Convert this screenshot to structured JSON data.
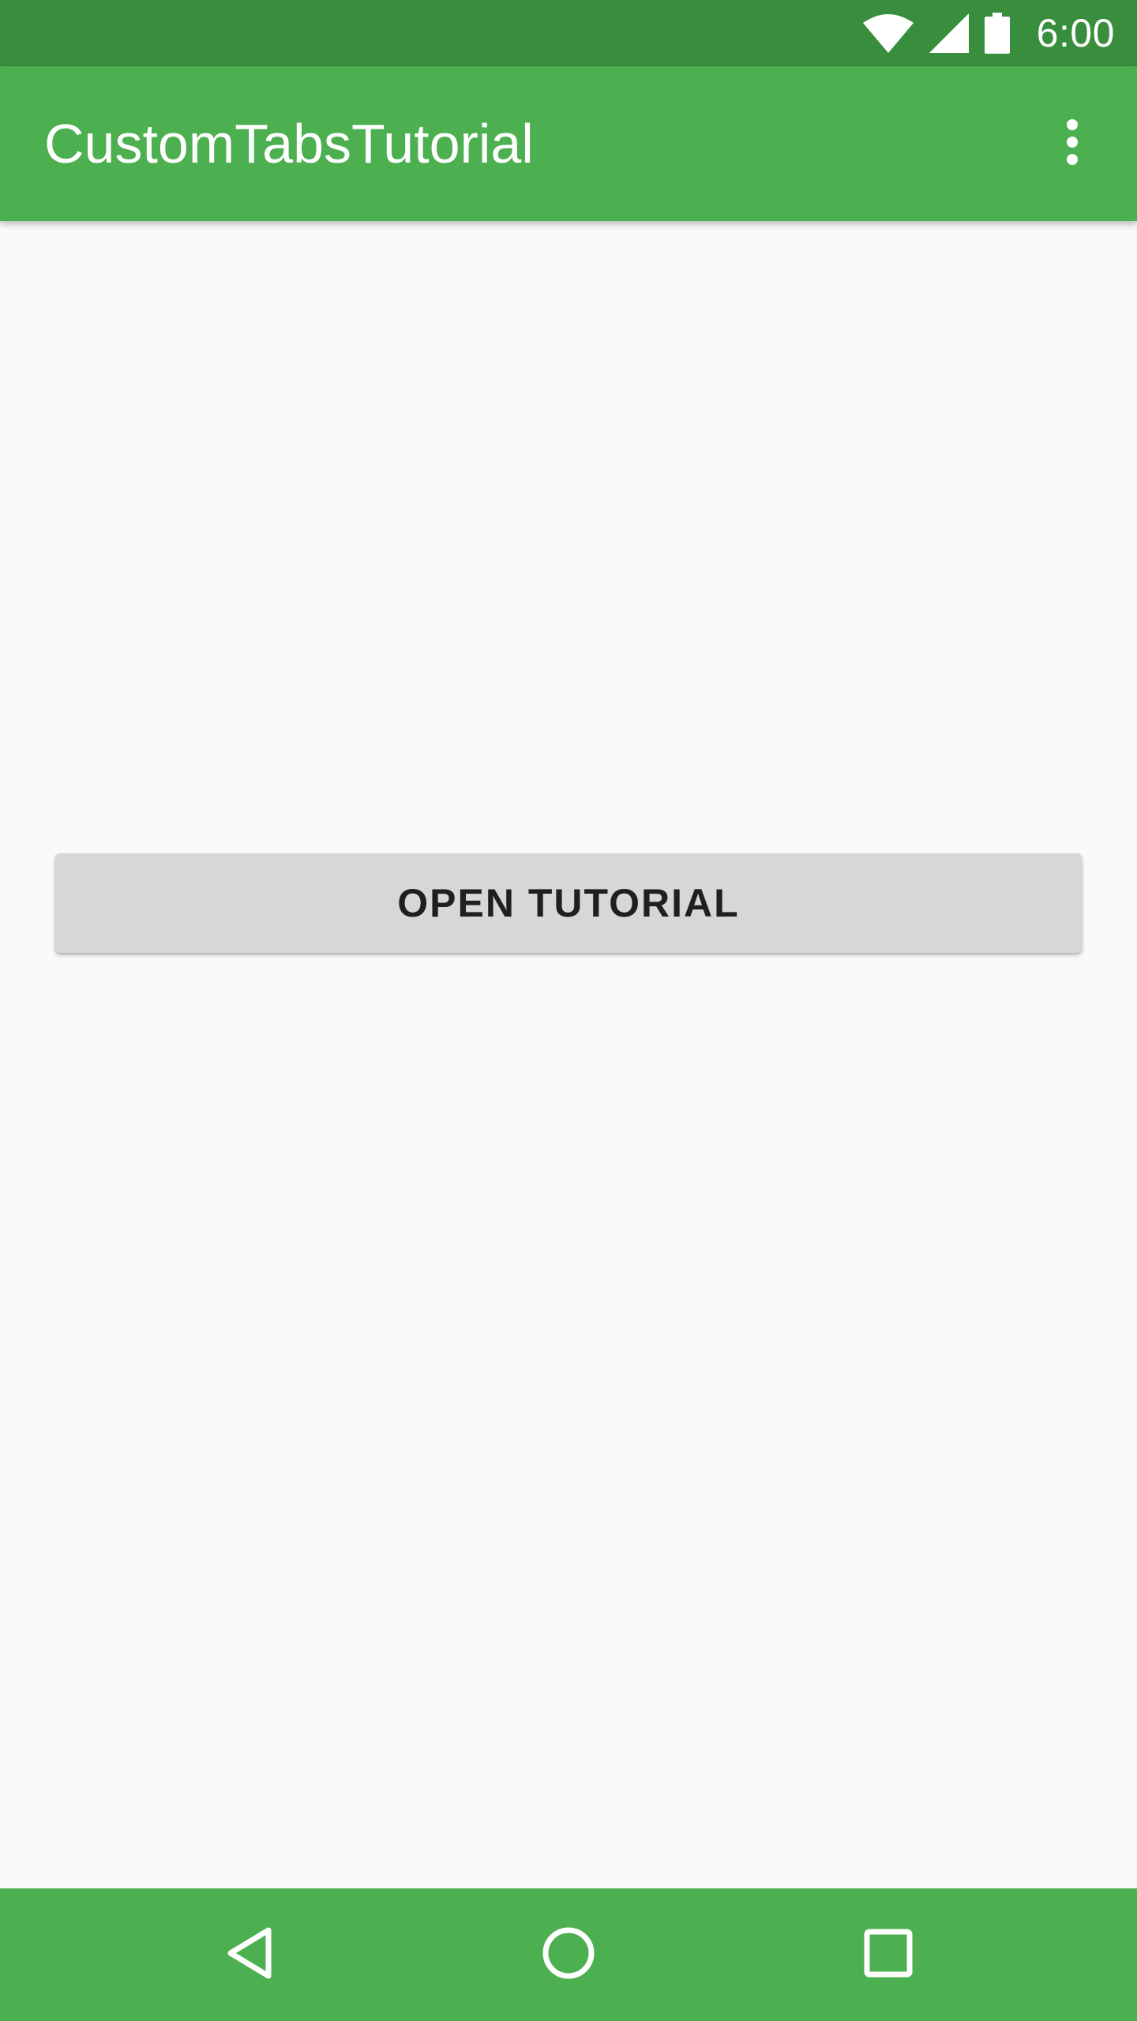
{
  "status_bar": {
    "time": "6:00",
    "icons": [
      "wifi-icon",
      "cell-signal-icon",
      "battery-icon"
    ],
    "color": "#388E3C"
  },
  "app_bar": {
    "title": "CustomTabsTutorial",
    "overflow_icon": "more-vert-icon",
    "color": "#4CAF50"
  },
  "main": {
    "open_button_label": "OPEN TUTORIAL",
    "button_color": "#D6D7D7",
    "background": "#FAFAFA"
  },
  "nav_bar": {
    "icons": [
      "back-icon",
      "home-icon",
      "recents-icon"
    ],
    "color": "#4CAF50"
  }
}
